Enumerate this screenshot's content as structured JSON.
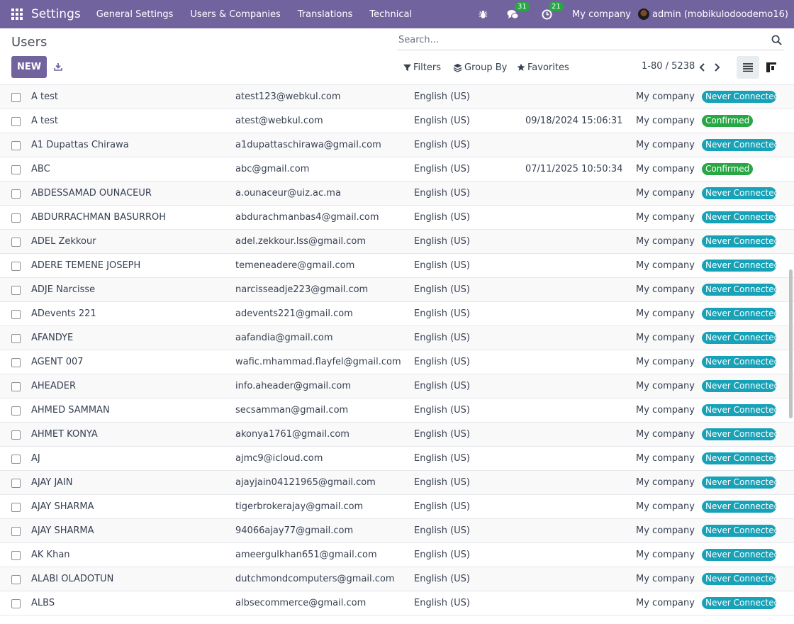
{
  "navbar": {
    "app_name": "Settings",
    "menu": [
      "General Settings",
      "Users & Companies",
      "Translations",
      "Technical"
    ],
    "messages_count": "31",
    "activities_count": "21",
    "company": "My company",
    "user": "admin (mobikulodoodemo16)"
  },
  "control": {
    "title": "Users",
    "new_label": "NEW",
    "search_placeholder": "Search...",
    "filters_label": "Filters",
    "group_by_label": "Group By",
    "favorites_label": "Favorites",
    "pager": "1-80 / 5238"
  },
  "colors": {
    "brand": "#71639e",
    "never_connected": "#17a2b8",
    "confirmed": "#28a745"
  },
  "rows": [
    {
      "name": "A test",
      "login": "atest123@webkul.com",
      "lang": "English (US)",
      "date": "",
      "company": "My company",
      "status": "Never Connected",
      "state": "never"
    },
    {
      "name": "A test",
      "login": "atest@webkul.com",
      "lang": "English (US)",
      "date": "09/18/2024 15:06:31",
      "company": "My company",
      "status": "Confirmed",
      "state": "confirmed"
    },
    {
      "name": "A1 Dupattas Chirawa",
      "login": "a1dupattaschirawa@gmail.com",
      "lang": "English (US)",
      "date": "",
      "company": "My company",
      "status": "Never Connected",
      "state": "never"
    },
    {
      "name": "ABC",
      "login": "abc@gmail.com",
      "lang": "English (US)",
      "date": "07/11/2025 10:50:34",
      "company": "My company",
      "status": "Confirmed",
      "state": "confirmed"
    },
    {
      "name": "ABDESSAMAD OUNACEUR",
      "login": "a.ounaceur@uiz.ac.ma",
      "lang": "English (US)",
      "date": "",
      "company": "My company",
      "status": "Never Connected",
      "state": "never"
    },
    {
      "name": "ABDURRACHMAN BASURROH",
      "login": "abdurachmanbas4@gmail.com",
      "lang": "English (US)",
      "date": "",
      "company": "My company",
      "status": "Never Connected",
      "state": "never"
    },
    {
      "name": "ADEL Zekkour",
      "login": "adel.zekkour.lss@gmail.com",
      "lang": "English (US)",
      "date": "",
      "company": "My company",
      "status": "Never Connected",
      "state": "never"
    },
    {
      "name": "ADERE TEMENE JOSEPH",
      "login": "temeneadere@gmail.com",
      "lang": "English (US)",
      "date": "",
      "company": "My company",
      "status": "Never Connected",
      "state": "never"
    },
    {
      "name": "ADJE Narcisse",
      "login": "narcisseadje223@gmail.com",
      "lang": "English (US)",
      "date": "",
      "company": "My company",
      "status": "Never Connected",
      "state": "never"
    },
    {
      "name": "ADevents 221",
      "login": "adevents221@gmail.com",
      "lang": "English (US)",
      "date": "",
      "company": "My company",
      "status": "Never Connected",
      "state": "never"
    },
    {
      "name": "AFANDYE",
      "login": "aafandia@gmail.com",
      "lang": "English (US)",
      "date": "",
      "company": "My company",
      "status": "Never Connected",
      "state": "never"
    },
    {
      "name": "AGENT 007",
      "login": "wafic.mhammad.flayfel@gmail.com",
      "lang": "English (US)",
      "date": "",
      "company": "My company",
      "status": "Never Connected",
      "state": "never"
    },
    {
      "name": "AHEADER",
      "login": "info.aheader@gmail.com",
      "lang": "English (US)",
      "date": "",
      "company": "My company",
      "status": "Never Connected",
      "state": "never"
    },
    {
      "name": "AHMED SAMMAN",
      "login": "secsamman@gmail.com",
      "lang": "English (US)",
      "date": "",
      "company": "My company",
      "status": "Never Connected",
      "state": "never"
    },
    {
      "name": "AHMET KONYA",
      "login": "akonya1761@gmail.com",
      "lang": "English (US)",
      "date": "",
      "company": "My company",
      "status": "Never Connected",
      "state": "never"
    },
    {
      "name": "AJ",
      "login": "ajmc9@icloud.com",
      "lang": "English (US)",
      "date": "",
      "company": "My company",
      "status": "Never Connected",
      "state": "never"
    },
    {
      "name": "AJAY JAIN",
      "login": "ajayjain04121965@gmail.com",
      "lang": "English (US)",
      "date": "",
      "company": "My company",
      "status": "Never Connected",
      "state": "never"
    },
    {
      "name": "AJAY SHARMA",
      "login": "tigerbrokerajay@gmail.com",
      "lang": "English (US)",
      "date": "",
      "company": "My company",
      "status": "Never Connected",
      "state": "never"
    },
    {
      "name": "AJAY SHARMA",
      "login": "94066ajay77@gmail.com",
      "lang": "English (US)",
      "date": "",
      "company": "My company",
      "status": "Never Connected",
      "state": "never"
    },
    {
      "name": "AK Khan",
      "login": "ameergulkhan651@gmail.com",
      "lang": "English (US)",
      "date": "",
      "company": "My company",
      "status": "Never Connected",
      "state": "never"
    },
    {
      "name": "ALABI OLADOTUN",
      "login": "dutchmondcomputers@gmail.com",
      "lang": "English (US)",
      "date": "",
      "company": "My company",
      "status": "Never Connected",
      "state": "never"
    },
    {
      "name": "ALBS",
      "login": "albsecommerce@gmail.com",
      "lang": "English (US)",
      "date": "",
      "company": "My company",
      "status": "Never Connected",
      "state": "never"
    }
  ]
}
